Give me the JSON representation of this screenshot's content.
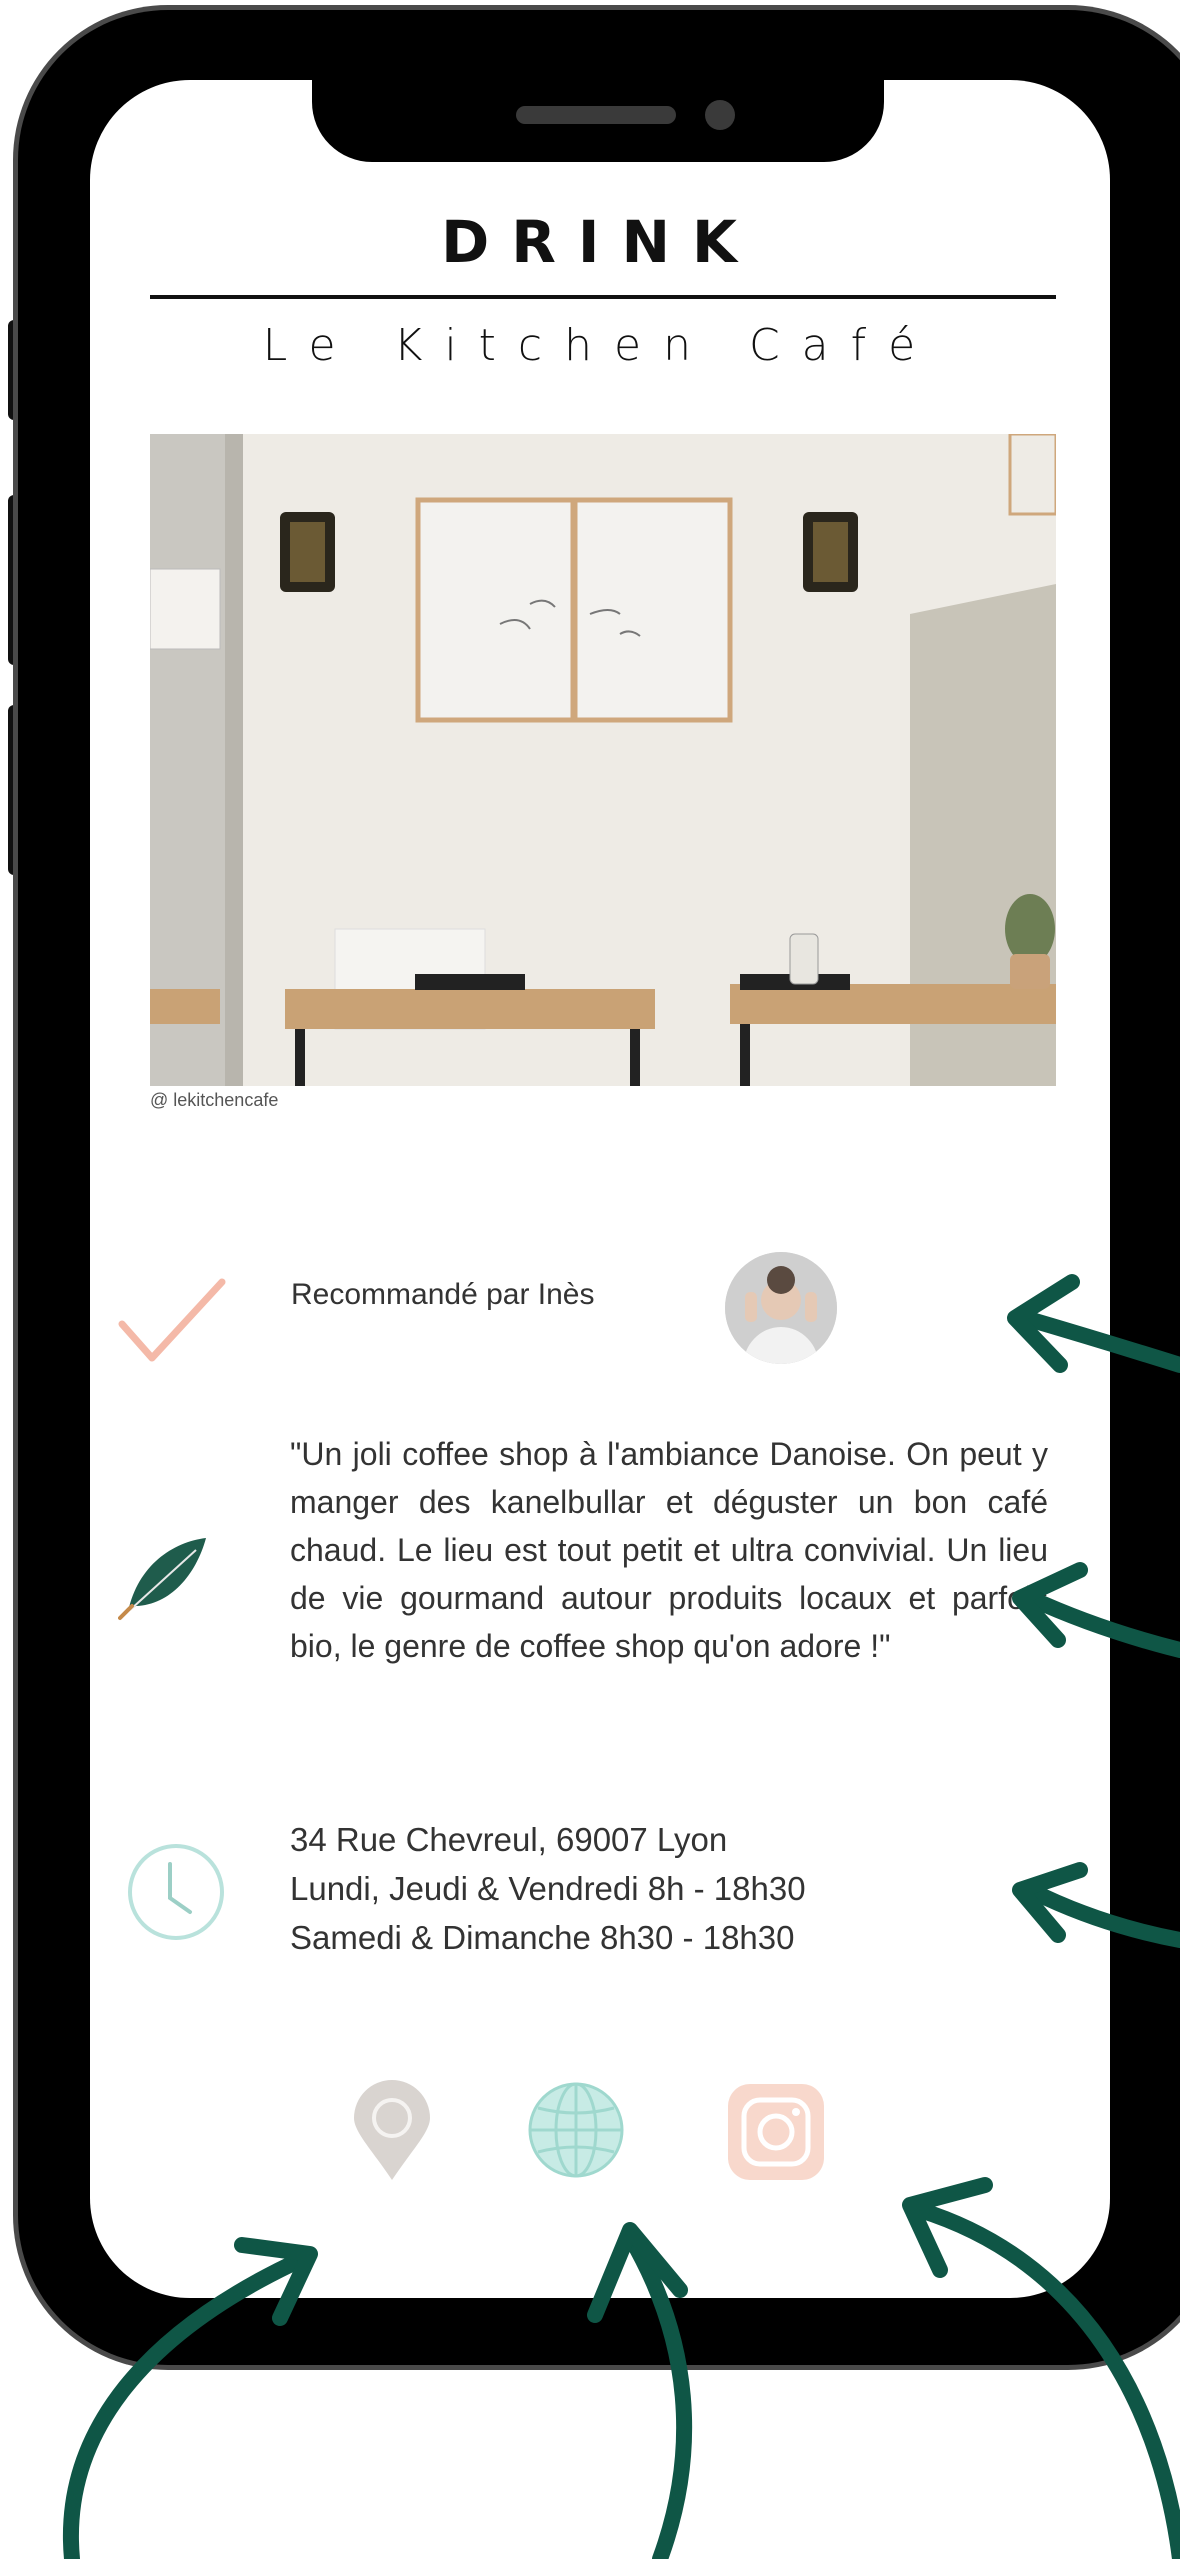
{
  "header": {
    "title": "DRINK",
    "subtitle": "Le Kitchen Café"
  },
  "photo": {
    "credit": "@ lekitchencafe"
  },
  "recommendation": {
    "text": "Recommandé par Inès",
    "icon": "checkmark-icon"
  },
  "review": {
    "icon": "leaf-icon",
    "text": "\"Un joli coffee shop à l'ambiance Danoise. On peut y manger des kanelbullar et déguster un bon café chaud. Le lieu est tout petit et ultra convivial. Un lieu de vie gourmand autour produits locaux et parfois bio, le genre de coffee shop qu'on adore !\""
  },
  "info": {
    "icon": "clock-icon",
    "address": "34 Rue Chevreul, 69007 Lyon",
    "hours_weekday": "Lundi, Jeudi & Vendredi 8h - 18h30",
    "hours_weekend": "Samedi & Dimanche 8h30 - 18h30"
  },
  "actions": [
    {
      "name": "map-pin-icon",
      "color": "#d9d4d0"
    },
    {
      "name": "globe-icon",
      "color": "#b9e2dc"
    },
    {
      "name": "instagram-icon",
      "color": "#f8d8cc"
    }
  ],
  "colors": {
    "check": "#f4b9a8",
    "leaf": "#1f5c4c",
    "clock": "#b9e2dc",
    "arrow": "#0f5646"
  }
}
